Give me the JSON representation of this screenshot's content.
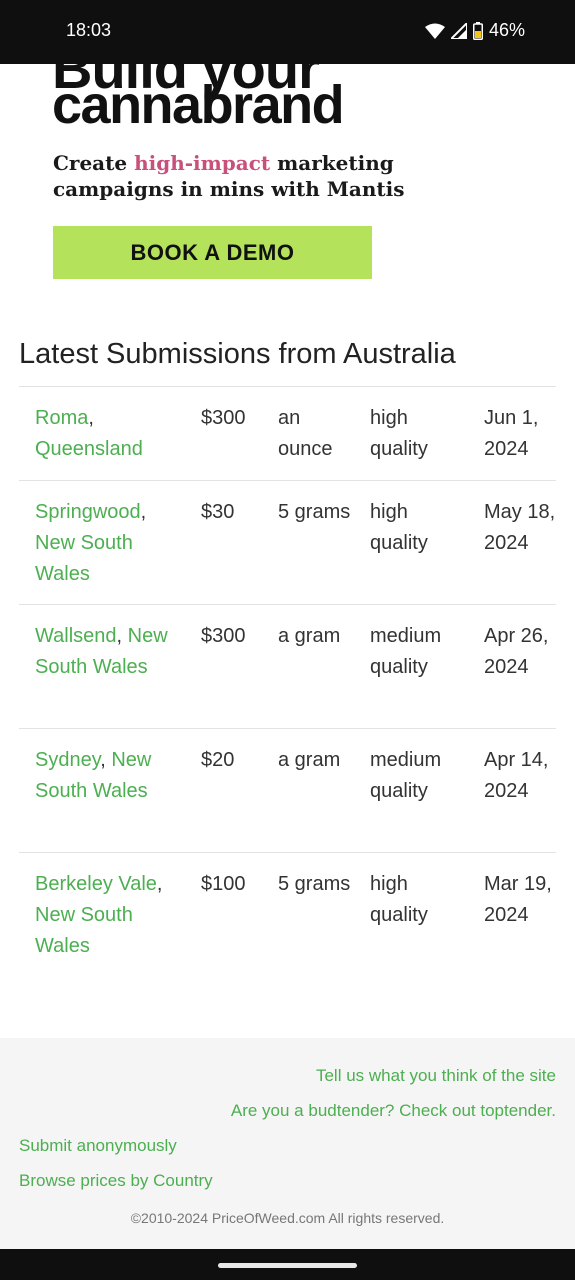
{
  "status_bar": {
    "time": "18:03",
    "battery": "46%",
    "icons": [
      "wifi-icon",
      "cell-signal-icon",
      "battery-icon"
    ]
  },
  "ad": {
    "headline_partial": "Build your",
    "headline": "cannabrand",
    "sub_pre": "Create ",
    "sub_highlight": "high-impact",
    "sub_post": " marketing",
    "sub_line2": "campaigns in mins with Mantis",
    "cta": "BOOK A DEMO",
    "highlight_color": "#c8507a",
    "cta_color": "#b4e35b"
  },
  "section": {
    "title": "Latest Submissions from Australia"
  },
  "submissions": [
    {
      "city": "Roma",
      "sep": ",",
      "region": "Queensland",
      "price": "$300",
      "qty": "an ounce",
      "quality": "high quality",
      "date": "Jun 1, 2024"
    },
    {
      "city": "Springwood",
      "sep": ",",
      "region": "New South Wales",
      "price": "$30",
      "qty": "5 grams",
      "quality": "high quality",
      "date": "May 18, 2024"
    },
    {
      "city": "Wallsend",
      "sep": ",",
      "region": "New South Wales",
      "price": "$300",
      "qty": "a gram",
      "quality": "medium quality",
      "date": "Apr 26, 2024"
    },
    {
      "city": "Sydney",
      "sep": ",",
      "region": "New South Wales",
      "price": "$20",
      "qty": "a gram",
      "quality": "medium quality",
      "date": "Apr 14, 2024"
    },
    {
      "city": "Berkeley Vale",
      "sep": ",",
      "region": "New South Wales",
      "price": "$100",
      "qty": "5 grams",
      "quality": "high quality",
      "date": "Mar 19, 2024"
    }
  ],
  "footer": {
    "feedback_link": "Tell us what you think of the site",
    "budtender_link": "Are you a budtender? Check out toptender.",
    "submit_link": "Submit anonymously",
    "browse_link": "Browse prices by Country",
    "copyright": "©2010-2024 PriceOfWeed.com All rights reserved."
  },
  "colors": {
    "link": "#4caf50",
    "footer_bg": "#f5f5f5"
  }
}
